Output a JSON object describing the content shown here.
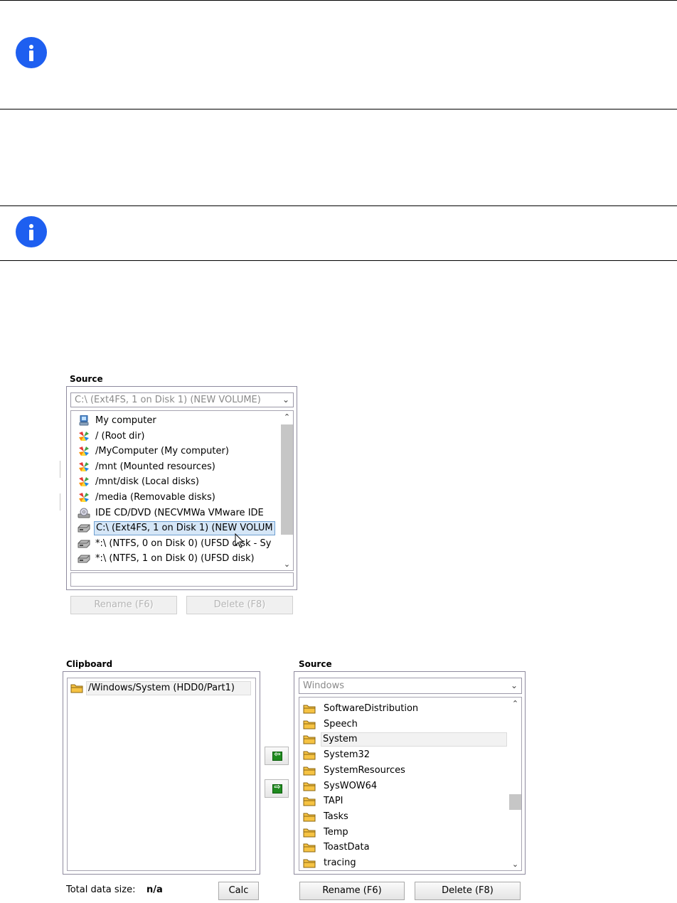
{
  "top_source": {
    "label": "Source",
    "combo_value": "C:\\  (Ext4FS, 1 on Disk 1) (NEW VOLUME)",
    "items": [
      {
        "icon": "computer-icon",
        "label": "My computer"
      },
      {
        "icon": "folder-colorful-icon",
        "label": "/ (Root dir)"
      },
      {
        "icon": "folder-colorful-icon",
        "label": "/MyComputer (My computer)"
      },
      {
        "icon": "folder-colorful-icon",
        "label": "/mnt (Mounted resources)"
      },
      {
        "icon": "folder-colorful-icon",
        "label": "/mnt/disk (Local disks)"
      },
      {
        "icon": "folder-colorful-icon",
        "label": "/media (Removable disks)"
      },
      {
        "icon": "cd-drive-icon",
        "label": "IDE CD/DVD (NECVMWa VMware IDE"
      },
      {
        "icon": "hard-disk-icon",
        "label": "C:\\  (Ext4FS, 1 on Disk 1) (NEW VOLUM"
      },
      {
        "icon": "hard-disk-icon",
        "label": "*:\\  (NTFS, 0 on Disk 0) (UFSD disk - Sy"
      },
      {
        "icon": "hard-disk-icon",
        "label": "*:\\  (NTFS, 1 on Disk 0) (UFSD disk)"
      }
    ],
    "selected_index": 7,
    "rename_label": "Rename (F6)",
    "delete_label": "Delete (F8)"
  },
  "clipboard": {
    "label": "Clipboard",
    "items": [
      {
        "icon": "folder-icon",
        "label": "/Windows/System (HDD0/Part1)"
      }
    ],
    "total_label": "Total data size:",
    "total_value": "n/a",
    "calc_label": "Calc"
  },
  "bottom_source": {
    "label": "Source",
    "combo_value": "Windows",
    "items": [
      {
        "icon": "folder-icon",
        "label": "SoftwareDistribution"
      },
      {
        "icon": "folder-icon",
        "label": "Speech"
      },
      {
        "icon": "folder-icon",
        "label": "System"
      },
      {
        "icon": "folder-icon",
        "label": "System32"
      },
      {
        "icon": "folder-icon",
        "label": "SystemResources"
      },
      {
        "icon": "folder-icon",
        "label": "SysWOW64"
      },
      {
        "icon": "folder-icon",
        "label": "TAPI"
      },
      {
        "icon": "folder-icon",
        "label": "Tasks"
      },
      {
        "icon": "folder-icon",
        "label": "Temp"
      },
      {
        "icon": "folder-icon",
        "label": "ToastData"
      },
      {
        "icon": "folder-icon",
        "label": "tracing"
      }
    ],
    "selected_index": 2,
    "rename_label": "Rename (F6)",
    "delete_label": "Delete (F8)"
  },
  "colors": {
    "info_blue": "#1e5ff0",
    "selection_blue": "#d5e6f7",
    "arrow_green": "#1f8a1f"
  }
}
